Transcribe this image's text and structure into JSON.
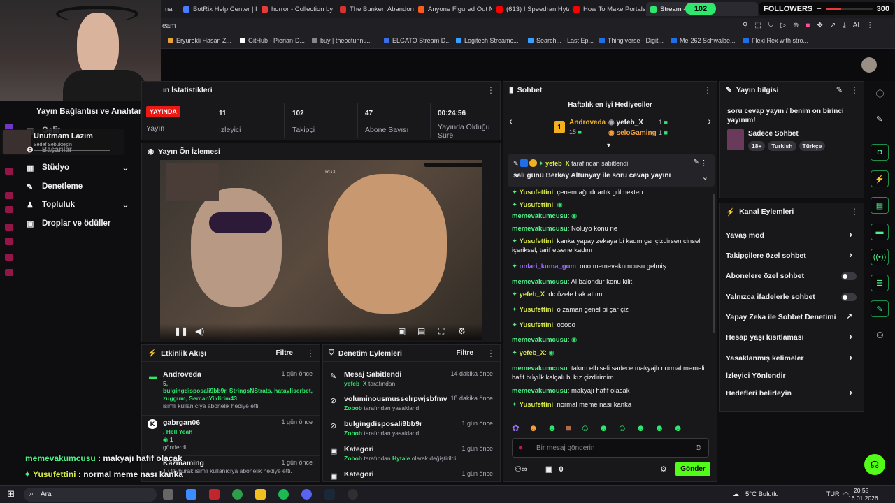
{
  "browser": {
    "tabs": [
      {
        "label": "na",
        "color": "#888"
      },
      {
        "label": "BotRix Help Center | I",
        "color": "#4a7cff"
      },
      {
        "label": "horror - Collection by",
        "color": "#e83a3a"
      },
      {
        "label": "The Bunker: Abandon",
        "color": "#d6322f"
      },
      {
        "label": "Anyone Figured Out M",
        "color": "#ff5a1f"
      },
      {
        "label": "(613) I Speedran Hyta",
        "color": "#ff0000"
      },
      {
        "label": "How To Make Portals",
        "color": "#ff0000"
      },
      {
        "label": "Stream -",
        "color": "#2ee86e"
      }
    ],
    "address_text": "eam",
    "bookmarks": [
      {
        "label": "Eryurekli Hasan Z...",
        "color": "#e8a23a"
      },
      {
        "label": "GitHub - Pierian-D...",
        "color": "#ffffff"
      },
      {
        "label": "buy | theoctunnu...",
        "color": "#888888"
      },
      {
        "label": "ELGATO Stream D...",
        "color": "#3a6ee8"
      },
      {
        "label": "Logitech Streamc...",
        "color": "#3aa0ff"
      },
      {
        "label": "Search... - Last Ep...",
        "color": "#3aa0ff"
      },
      {
        "label": "Thingiverse - Digit...",
        "color": "#1e6fe8"
      },
      {
        "label": "Me-262 Schwalbe...",
        "color": "#1e6fe8"
      },
      {
        "label": "Flexi Rex with stro...",
        "color": "#1e6fe8"
      }
    ]
  },
  "overlay": {
    "counter_value": "102",
    "followers_label": "FOLLOWERS",
    "followers_plus": "+",
    "followers_goal": "300",
    "name_card": {
      "name": "Unutmam Lazım",
      "sub": "Sedef Sebükteşin"
    }
  },
  "left_nav": {
    "header": "Yayın Bağlantısı ve Anahtarı",
    "items": [
      {
        "label": "Gelir"
      },
      {
        "label": "Başarılar"
      },
      {
        "label": "Stüdyo",
        "expand": true
      },
      {
        "label": "Denetleme"
      },
      {
        "label": "Topluluk",
        "expand": true
      },
      {
        "label": "Droplar ve ödüller"
      }
    ]
  },
  "stats": {
    "title": "Yayın İstatistikleri",
    "title_visible": "ın İstatistikleri",
    "live_badge": "YAYINDA",
    "live_label": "Yayın",
    "items": [
      {
        "value": "11",
        "label": "İzleyici"
      },
      {
        "value": "102",
        "label": "Takipçi"
      },
      {
        "value": "47",
        "label": "Abone Sayısı"
      },
      {
        "value": "00:24:56",
        "label": "Yayında Olduğu Süre"
      }
    ]
  },
  "preview": {
    "title": "Yayın Ön İzlemesi",
    "overlay_text": "RGX",
    "chat_overlay": [
      {
        "user": "memevakumcusu",
        "text": "makyajı hafif olacak"
      },
      {
        "user": "Yusufettini",
        "text": "normal meme nası kanka"
      }
    ]
  },
  "activity": {
    "title": "Etkinlik Akışı",
    "filter": "Filtre",
    "items": [
      {
        "user": "Androveda",
        "time": "1 gün önce",
        "line1": "5,",
        "names": "bulgingdisposali9bb9r, StringsNStrats, hatayliserbet, zuggum, SercanYildirim43",
        "line3": "isimli kullanıcıya abonelik hediye etti."
      },
      {
        "user": "gabrgan06",
        "time": "1 gün önce",
        "line1": ", Hell Yeah",
        "amount": "1",
        "line3": "gönderdi"
      },
      {
        "user": "Kazmaming",
        "time": "1 gün önce",
        "line1": "1 Ozyburak isimli kullanıcıya abonelik hediye etti."
      }
    ]
  },
  "moderation": {
    "title": "Denetim Eylemleri",
    "filter": "Filtre",
    "items": [
      {
        "title": "Mesaj Sabitlendi",
        "time": "14 dakika önce",
        "by": "yefeb_X",
        "suffix": "tarafından"
      },
      {
        "title": "voluminousmusselrpwjsbfmv",
        "time": "18 dakika önce",
        "by": "Zobob",
        "suffix": "tarafından yasaklandı"
      },
      {
        "title": "bulgingdisposali9bb9r",
        "time": "1 gün önce",
        "by": "Zobob",
        "suffix": "tarafından yasaklandı"
      },
      {
        "title": "Kategori",
        "time": "1 gün önce",
        "by": "Zobob",
        "suffix": "tarafından",
        "game": "Hytale",
        "suffix2": "olarak değiştirildi"
      },
      {
        "title": "Kategori",
        "time": "1 gün önce"
      }
    ]
  },
  "chat": {
    "title": "Sohbet",
    "gifters_title": "Haftalık en iyi Hediyeciler",
    "gifters": [
      {
        "rank": "1",
        "name": "Androveda",
        "count": "15"
      },
      {
        "name": "yefeb_X",
        "count": "1"
      },
      {
        "name": "seloGaming",
        "count": "1"
      }
    ],
    "pinned": {
      "user": "yefeb_X",
      "suffix": "tarafından sabitlendi",
      "text": "salı günü Berkay Altunyay ile soru cevap yayını"
    },
    "messages": [
      {
        "user": "Yusufettini",
        "text": "çenem ağrıdı artık gülmekten",
        "color": "uy"
      },
      {
        "user": "Yusufettini",
        "text": "",
        "color": "uy"
      },
      {
        "user": "memevakumcusu",
        "text": "",
        "color": "ug"
      },
      {
        "user": "memevakumcusu",
        "text": "Noluyo konu ne",
        "color": "ug"
      },
      {
        "user": "Yusufettini",
        "text": "kanka yapay zekaya bi kadın çar çizdirsen cinsel içeriksel, tarif etsene kadını",
        "color": "uy"
      },
      {
        "user": "onlari_kuma_gom",
        "text": "ooo memevakumcusu gelmiş",
        "color": "up"
      },
      {
        "user": "memevakumcusu",
        "text": "Al balondur konu kilit.",
        "color": "ug"
      },
      {
        "user": "yefeb_X",
        "text": "dc özele bak attım",
        "color": "uy"
      },
      {
        "user": "Yusufettini",
        "text": "o zaman genel bi çar çiz",
        "color": "uy"
      },
      {
        "user": "Yusufettini",
        "text": "ooooo",
        "color": "uy"
      },
      {
        "user": "memevakumcusu",
        "text": "",
        "color": "ug"
      },
      {
        "user": "yefeb_X",
        "text": "",
        "color": "uy"
      },
      {
        "user": "memevakumcusu",
        "text": "takım elbiseli sadece makyajlı normal memeli hafif büyük kalçalı bi kız çizdirirdim.",
        "color": "ug"
      },
      {
        "user": "memevakumcusu",
        "text": "makyajı hafif olacak",
        "color": "ug"
      },
      {
        "user": "Yusufettini",
        "text": "normal meme nası kanka",
        "color": "uy"
      }
    ],
    "input_placeholder": "Bir mesaj gönderin",
    "points": "0",
    "send": "Gönder"
  },
  "stream_info": {
    "title": "Yayın bilgisi",
    "stream_title": "soru cevap yayın / benim on birinci yayınım!",
    "category": "Sadece Sohbet",
    "tags": [
      "18+",
      "Turkish",
      "Türkçe"
    ]
  },
  "channel_actions": {
    "title": "Kanal Eylemleri",
    "items": [
      {
        "label": "Yavaş mod",
        "type": "chev"
      },
      {
        "label": "Takipçilere özel sohbet",
        "type": "chev"
      },
      {
        "label": "Abonelere özel sohbet",
        "type": "toggle"
      },
      {
        "label": "Yalnızca ifadelerle sohbet",
        "type": "toggle"
      },
      {
        "label": "Yapay Zeka ile Sohbet Denetimi",
        "type": "ext"
      },
      {
        "label": "Hesap yaşı kısıtlaması",
        "type": "chev"
      },
      {
        "label": "Yasaklanmış kelimeler",
        "type": "chev"
      },
      {
        "label": "İzleyici Yönlendir",
        "type": "none"
      },
      {
        "label": "Hedefleri belirleyin",
        "type": "chev"
      }
    ]
  },
  "taskbar": {
    "search": "Ara",
    "weather": "5°C Bulutlu",
    "lang": "TUR",
    "time": "20:55",
    "date": "16.01.2026"
  }
}
